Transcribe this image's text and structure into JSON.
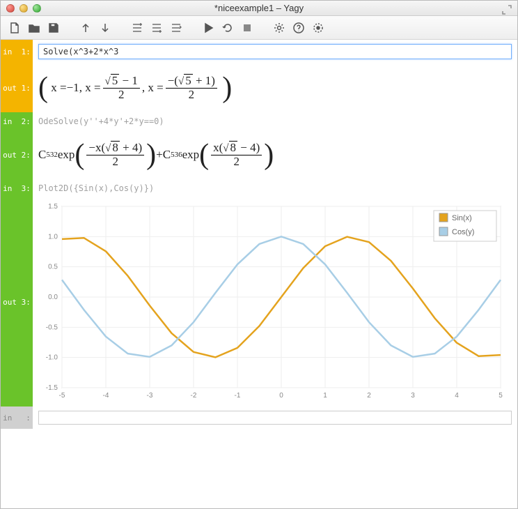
{
  "window": {
    "title": "*niceexample1 – Yagy"
  },
  "toolbar": {
    "icons": [
      "new",
      "open",
      "save",
      "sep",
      "up",
      "down",
      "sep",
      "insert-before",
      "insert-after",
      "cell-swap",
      "sep",
      "run",
      "refresh",
      "stop",
      "sep",
      "settings",
      "help",
      "target"
    ]
  },
  "cells": {
    "in1": {
      "label": "in  1:",
      "value": "Solve(x^3+2*x^3"
    },
    "out1": {
      "label": "out 1:",
      "text_prefix": "x = ",
      "neg1": "−1",
      "comma": " , x = ",
      "root5": "5",
      "minus1": " − 1",
      "two": "2",
      "comma2": " , x = ",
      "neg_open": "−(",
      "plus1": " + 1)",
      "two_b": "2"
    },
    "in2": {
      "label": "in  2:",
      "value": "OdeSolve(y''+4*y'+2*y==0)"
    },
    "out2": {
      "label": "out 2:",
      "c1": "C",
      "c1sub": "532",
      "exp": " exp",
      "negx": "−x(",
      "root8": "8",
      "plus4": " + 4)",
      "two": "2",
      "plus": " + ",
      "c2": "C",
      "c2sub": "536",
      "x": "x(",
      "minus4": " − 4)"
    },
    "in3": {
      "label": "in  3:",
      "value": "Plot2D({Sin(x),Cos(y)})"
    },
    "out3": {
      "label": "out 3:"
    },
    "blank": {
      "label": "in   :"
    }
  },
  "chart_data": {
    "type": "line",
    "xlim": [
      -5,
      5
    ],
    "ylim": [
      -1.5,
      1.5
    ],
    "xticks": [
      -5,
      -4,
      -3,
      -2,
      -1,
      0,
      1,
      2,
      3,
      4,
      5
    ],
    "yticks": [
      -1.5,
      -1.0,
      -0.5,
      0.0,
      0.5,
      1.0,
      1.5
    ],
    "legend": {
      "position": "top-right",
      "entries": [
        {
          "name": "Sin(x)",
          "color": "#e4a31e"
        },
        {
          "name": "Cos(y)",
          "color": "#a8cee6"
        }
      ]
    },
    "series": [
      {
        "name": "Sin(x)",
        "color": "#e4a31e",
        "x": [
          -5,
          -4.5,
          -4,
          -3.5,
          -3,
          -2.5,
          -2,
          -1.5,
          -1,
          -0.5,
          0,
          0.5,
          1,
          1.5,
          2,
          2.5,
          3,
          3.5,
          4,
          4.5,
          5
        ],
        "y": [
          0.959,
          0.978,
          0.757,
          0.351,
          -0.141,
          -0.599,
          -0.909,
          -0.997,
          -0.841,
          -0.479,
          0.0,
          0.479,
          0.841,
          0.997,
          0.909,
          0.599,
          0.141,
          -0.351,
          -0.757,
          -0.978,
          -0.959
        ]
      },
      {
        "name": "Cos(y)",
        "color": "#a8cee6",
        "x": [
          -5,
          -4.5,
          -4,
          -3.5,
          -3,
          -2.5,
          -2,
          -1.5,
          -1,
          -0.5,
          0,
          0.5,
          1,
          1.5,
          2,
          2.5,
          3,
          3.5,
          4,
          4.5,
          5
        ],
        "y": [
          0.284,
          -0.211,
          -0.654,
          -0.936,
          -0.99,
          -0.801,
          -0.416,
          0.071,
          0.54,
          0.878,
          1.0,
          0.878,
          0.54,
          0.071,
          -0.416,
          -0.801,
          -0.99,
          -0.936,
          -0.654,
          -0.211,
          0.284
        ]
      }
    ]
  }
}
